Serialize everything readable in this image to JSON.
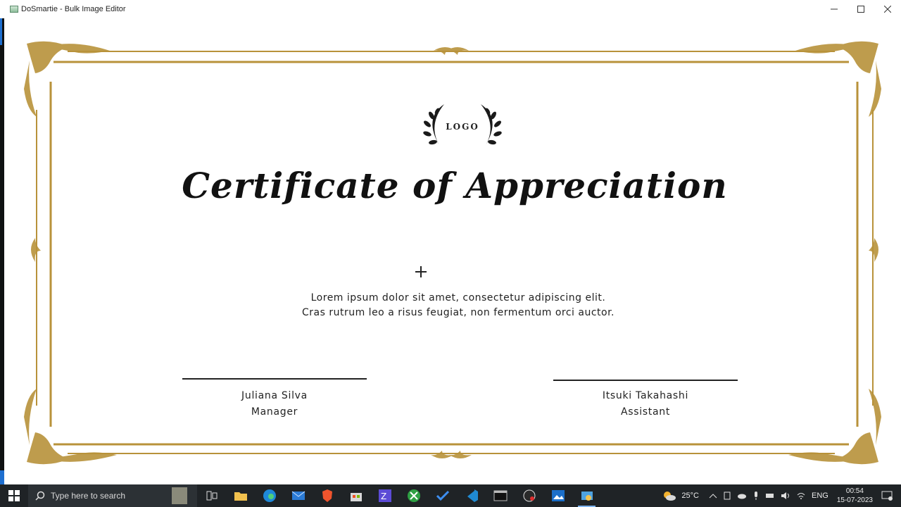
{
  "window": {
    "title": "DoSmartie - Bulk Image Editor",
    "controls": [
      "minimize-icon",
      "maximize-icon",
      "close-icon"
    ]
  },
  "certificate": {
    "logo_text": "LOGO",
    "title": "Certificate of Appreciation",
    "body_lines": [
      "Lorem ipsum dolor sit amet, consectetur adipiscing elit.",
      "Cras rutrum leo a risus feugiat, non fermentum orci auctor."
    ],
    "signatories": [
      {
        "name": "Juliana Silva",
        "role": "Manager"
      },
      {
        "name": "Itsuki Takahashi",
        "role": "Assistant"
      }
    ],
    "colors": {
      "border_gold": "#b8923a",
      "text": "#1a1a1a"
    }
  },
  "taskbar": {
    "search_placeholder": "Type here to search",
    "pinned_icons": [
      "file-explorer-tile-icon",
      "task-view-icon",
      "folder-icon",
      "edge-icon",
      "mail-icon",
      "brave-icon",
      "store-icon",
      "visual-studio-icon",
      "xbox-icon",
      "todo-icon",
      "vscode-icon",
      "terminal-icon",
      "obs-icon",
      "photos-icon",
      "dosmartie-icon"
    ],
    "weather": "25°C",
    "language": "ENG",
    "time": "00:54",
    "date": "15-07-2023"
  }
}
